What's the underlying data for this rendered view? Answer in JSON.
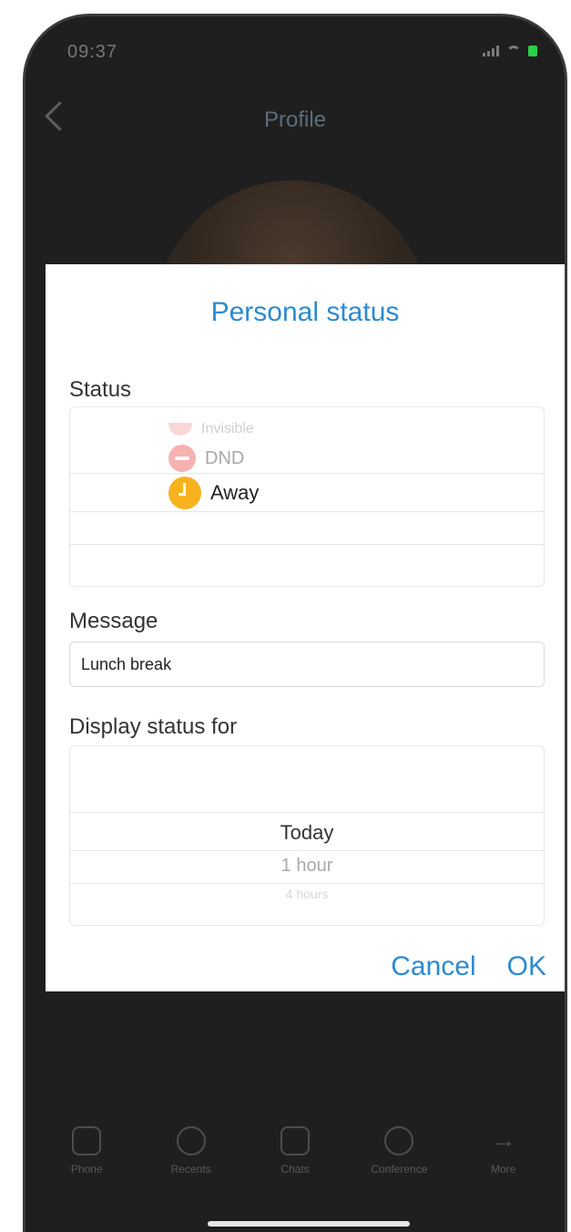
{
  "statusbar": {
    "time": "09:37"
  },
  "nav": {
    "title": "Profile"
  },
  "modal": {
    "title": "Personal status",
    "status_label": "Status",
    "status_picker": {
      "items": [
        {
          "label": "Invisible",
          "icon": "invisible-icon",
          "state": "faint"
        },
        {
          "label": "DND",
          "icon": "do-not-disturb-icon",
          "state": "near"
        },
        {
          "label": "Away",
          "icon": "away-clock-icon",
          "state": "selected"
        }
      ]
    },
    "message_label": "Message",
    "message_value": "Lunch break",
    "display_label": "Display status for",
    "display_picker": {
      "items": [
        {
          "label": "Today",
          "state": "selected"
        },
        {
          "label": "1 hour",
          "state": "near"
        },
        {
          "label": "4 hours",
          "state": "faint"
        }
      ]
    },
    "buttons": {
      "cancel": "Cancel",
      "ok": "OK"
    }
  },
  "tabbar": {
    "items": [
      {
        "label": "Phone",
        "icon": "dialpad-icon"
      },
      {
        "label": "Recents",
        "icon": "clock-icon"
      },
      {
        "label": "Chats",
        "icon": "chat-icon"
      },
      {
        "label": "Conference",
        "icon": "people-icon"
      },
      {
        "label": "More",
        "icon": "arrow-right-icon"
      }
    ]
  },
  "colors": {
    "accent": "#2d8ad0",
    "away": "#f7b21e",
    "dnd": "#f07d7d",
    "modal_bg": "#ffffff",
    "screen_bg": "#1f1f1f"
  }
}
